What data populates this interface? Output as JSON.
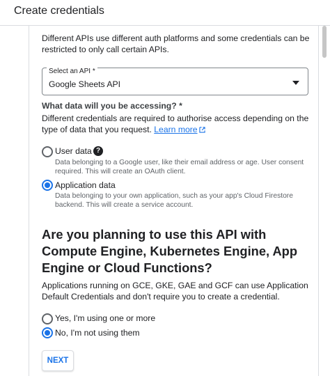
{
  "header": {
    "title": "Create credentials"
  },
  "intro_text": "Different APIs use different auth platforms and some credentials can be restricted to only call certain APIs.",
  "select_api": {
    "label": "Select an API *",
    "value": "Google Sheets API"
  },
  "data_access": {
    "question": "What data will you be accessing? *",
    "description": "Different credentials are required to authorise access depending on the type of data that you request.",
    "learn_more": "Learn more",
    "options": [
      {
        "label": "User data",
        "sub": "Data belonging to a Google user, like their email address or age. User consent required. This will create an OAuth client.",
        "selected": false
      },
      {
        "label": "Application data",
        "sub": "Data belonging to your own application, such as your app's Cloud Firestore backend. This will create a service account.",
        "selected": true
      }
    ]
  },
  "compute": {
    "heading": "Are you planning to use this API with Compute Engine, Kubernetes Engine, App Engine or Cloud Functions?",
    "description": "Applications running on GCE, GKE, GAE and GCF can use Application Default Credentials and don't require you to create a credential.",
    "options": [
      {
        "label": "Yes, I'm using one or more",
        "selected": false
      },
      {
        "label": "No, I'm not using them",
        "selected": true
      }
    ]
  },
  "next_button": "NEXT",
  "colors": {
    "accent": "#1a73e8",
    "text": "#202124",
    "secondary": "#5f6368"
  },
  "icons": {
    "help": "help-icon",
    "external": "external-link-icon",
    "dropdown": "dropdown-arrow-icon"
  }
}
